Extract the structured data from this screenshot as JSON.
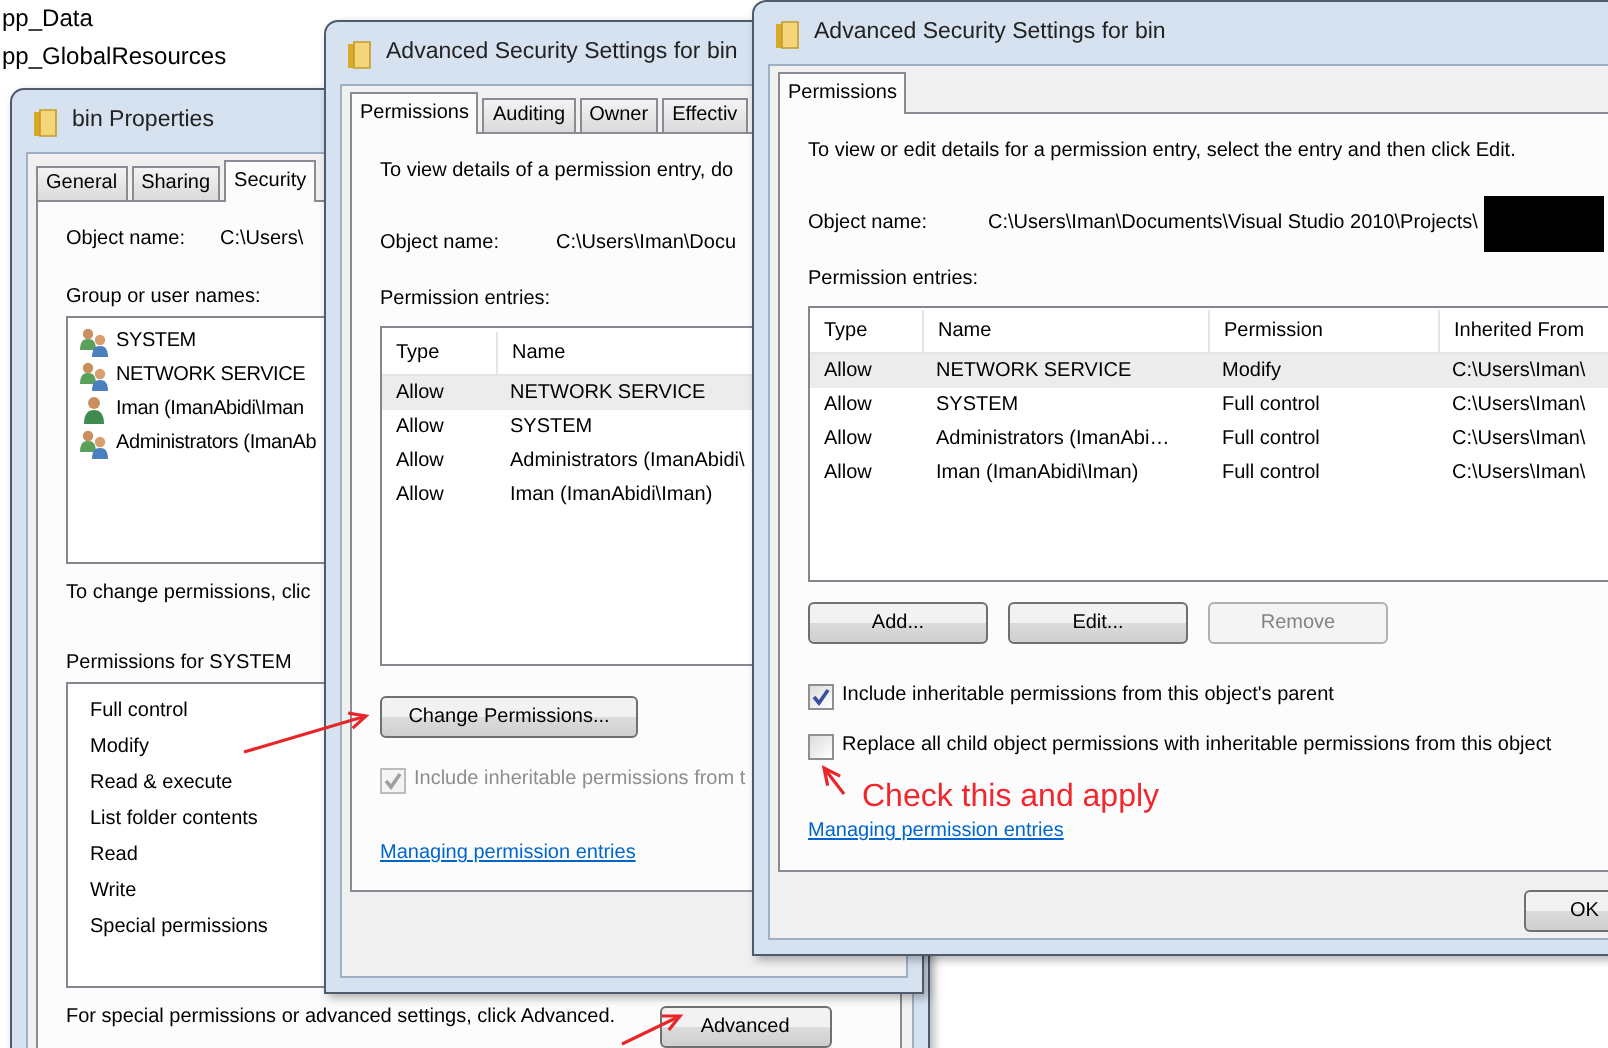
{
  "background_list": {
    "items": [
      "pp_Data",
      "pp_GlobalResources"
    ]
  },
  "properties_window": {
    "title": "bin Properties",
    "tabs": [
      {
        "label": "General",
        "selected": false
      },
      {
        "label": "Sharing",
        "selected": false
      },
      {
        "label": "Security",
        "selected": true
      }
    ],
    "object_name_label": "Object name:",
    "object_name": "C:\\Users\\",
    "groups_label": "Group or user names:",
    "groups": [
      {
        "name": "SYSTEM",
        "kind": "group"
      },
      {
        "name": "NETWORK SERVICE",
        "kind": "group"
      },
      {
        "name": "Iman (ImanAbidi\\Iman",
        "kind": "user"
      },
      {
        "name": "Administrators (ImanAb",
        "kind": "group"
      }
    ],
    "change_hint": "To change permissions, clic",
    "permissions_label": "Permissions for SYSTEM",
    "permissions": [
      "Full control",
      "Modify",
      "Read & execute",
      "List folder contents",
      "Read",
      "Write",
      "Special permissions"
    ],
    "advanced_hint": "For special permissions or advanced settings, click Advanced.",
    "advanced_button": "Advanced"
  },
  "advanced_window": {
    "title": "Advanced Security Settings for bin",
    "tabs": [
      {
        "label": "Permissions",
        "selected": true
      },
      {
        "label": "Auditing",
        "selected": false
      },
      {
        "label": "Owner",
        "selected": false
      },
      {
        "label": "Effectiv",
        "selected": false
      }
    ],
    "description": "To view details of a permission entry, do",
    "object_name_label": "Object name:",
    "object_name": "C:\\Users\\Iman\\Docu",
    "entries_label": "Permission entries:",
    "columns": [
      "Type",
      "Name"
    ],
    "rows": [
      {
        "cells": [
          "Allow",
          "NETWORK SERVICE"
        ],
        "selected": true
      },
      {
        "cells": [
          "Allow",
          "SYSTEM"
        ],
        "selected": false
      },
      {
        "cells": [
          "Allow",
          "Administrators (ImanAbidi\\"
        ],
        "selected": false
      },
      {
        "cells": [
          "Allow",
          "Iman (ImanAbidi\\Iman)"
        ],
        "selected": false
      }
    ],
    "change_button": "Change Permissions...",
    "inherit_checkbox": {
      "label": "Include inheritable permissions from t",
      "checked": true,
      "disabled": true
    },
    "link": "Managing permission entries"
  },
  "edit_window": {
    "title": "Advanced Security Settings for bin",
    "tabs": [
      {
        "label": "Permissions",
        "selected": true
      }
    ],
    "description": "To view or edit details for a permission entry, select the entry and then click Edit.",
    "object_name_label": "Object name:",
    "object_name": "C:\\Users\\Iman\\Documents\\Visual Studio 2010\\Projects\\",
    "entries_label": "Permission entries:",
    "columns": [
      "Type",
      "Name",
      "Permission",
      "Inherited From"
    ],
    "rows": [
      {
        "cells": [
          "Allow",
          "NETWORK SERVICE",
          "Modify",
          "C:\\Users\\Iman\\"
        ],
        "selected": true
      },
      {
        "cells": [
          "Allow",
          "SYSTEM",
          "Full control",
          "C:\\Users\\Iman\\"
        ],
        "selected": false
      },
      {
        "cells": [
          "Allow",
          "Administrators (ImanAbi…",
          "Full control",
          "C:\\Users\\Iman\\"
        ],
        "selected": false
      },
      {
        "cells": [
          "Allow",
          "Iman (ImanAbidi\\Iman)",
          "Full control",
          "C:\\Users\\Iman\\"
        ],
        "selected": false
      }
    ],
    "buttons": [
      {
        "label": "Add...",
        "disabled": false
      },
      {
        "label": "Edit...",
        "disabled": false
      },
      {
        "label": "Remove",
        "disabled": true
      }
    ],
    "checkboxes": [
      {
        "label": "Include inheritable permissions from this object's parent",
        "checked": true,
        "disabled": false
      },
      {
        "label": "Replace all child object permissions with inheritable permissions from this object",
        "checked": false,
        "disabled": false
      }
    ],
    "link": "Managing permission entries",
    "ok_button": "OK"
  },
  "annotation": {
    "text": "Check this and apply"
  }
}
